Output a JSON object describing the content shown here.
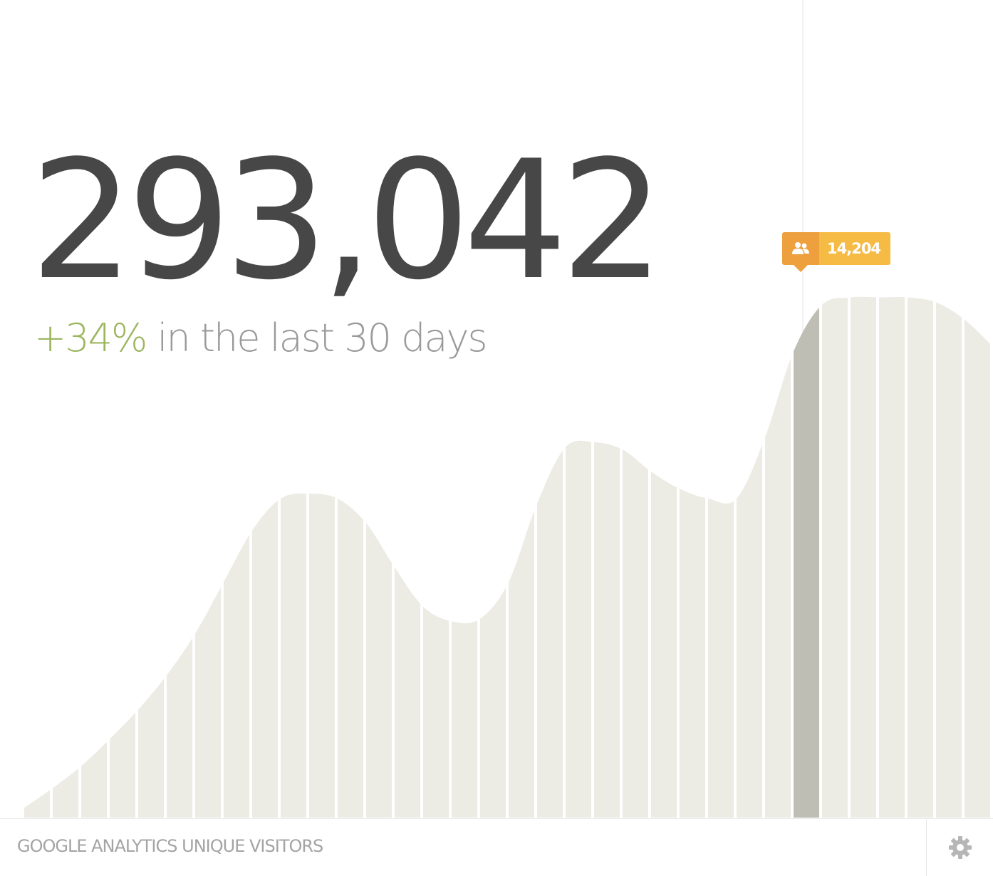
{
  "widget": {
    "total": "293,042",
    "change_percent": "+34%",
    "change_label": "in the last 30 days",
    "source_label": "GOOGLE ANALYTICS UNIQUE VISITORS"
  },
  "tooltip": {
    "icon": "users-icon",
    "value": "14,204"
  },
  "footer": {
    "settings_icon": "gear-icon"
  },
  "colors": {
    "big_number": "#474747",
    "delta": "#9cb65e",
    "muted_text": "#9a9a9a",
    "area_fill": "#ecebe4",
    "highlight_bar": "#bfbeb5",
    "tooltip_icon_bg": "#eda03d",
    "tooltip_value_bg": "#f5bb45"
  },
  "chart_data": {
    "type": "area",
    "style": "striped-bars",
    "highlight_index": 27,
    "values": [
      0.4,
      1.2,
      2.1,
      3.2,
      4.4,
      5.8,
      7.5,
      9.6,
      11.7,
      13.0,
      13.2,
      13.0,
      12.0,
      10.2,
      8.6,
      8.0,
      8.1,
      9.6,
      12.8,
      15.1,
      15.3,
      15.0,
      14.1,
      13.4,
      13.0,
      13.0,
      15.5,
      19.0,
      20.9,
      21.2,
      21.2,
      21.2,
      21.0,
      20.3,
      19.2
    ],
    "max_value": 22,
    "grid": false,
    "legend": "none"
  }
}
